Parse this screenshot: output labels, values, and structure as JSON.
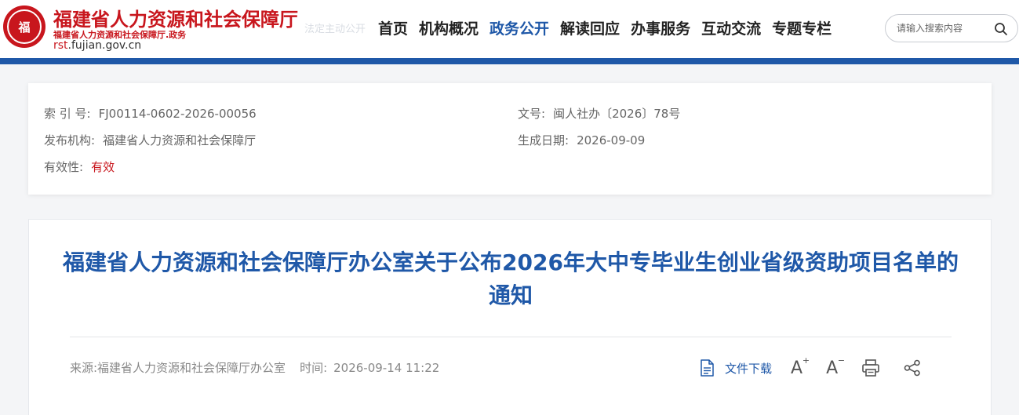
{
  "header": {
    "title": "福建省人力资源和社会保障厅",
    "subtitle": "福建省人力资源和社会保障厅.政务",
    "domain_prefix": "rst",
    "domain_suffix": ".fujian.gov.cn",
    "ghost_text": "法定主动公开",
    "emblem_text": "福"
  },
  "nav": {
    "items": [
      "首页",
      "机构概况",
      "政务公开",
      "解读回应",
      "办事服务",
      "互动交流",
      "专题专栏"
    ],
    "active": "政务公开"
  },
  "search": {
    "placeholder": "请输入搜索内容",
    "icon": "search-icon"
  },
  "meta": {
    "index_label": "索 引 号:",
    "index_value": "FJ00114-0602-2026-00056",
    "doc_no_label": "文号:",
    "doc_no_value": "闽人社办〔2026〕78号",
    "issuer_label": "发布机构:",
    "issuer_value": "福建省人力资源和社会保障厅",
    "date_label": "生成日期:",
    "date_value": "2026-09-09",
    "validity_label": "有效性:",
    "validity_value": "有效"
  },
  "article": {
    "title": "福建省人力资源和社会保障厅办公室关于公布2026年大中专毕业生创业省级资助项目名单的通知",
    "source": "来源:福建省人力资源和社会保障厅办公室",
    "time_label": "时间:",
    "time_value": "2026-09-14 11:22",
    "download_label": "文件下载"
  },
  "tools": {
    "font_increase": "A",
    "font_increase_mark": "+",
    "font_decrease": "A",
    "font_decrease_mark": "−"
  },
  "colors": {
    "brand_red": "#c8161d",
    "brand_blue": "#1f58a8"
  }
}
